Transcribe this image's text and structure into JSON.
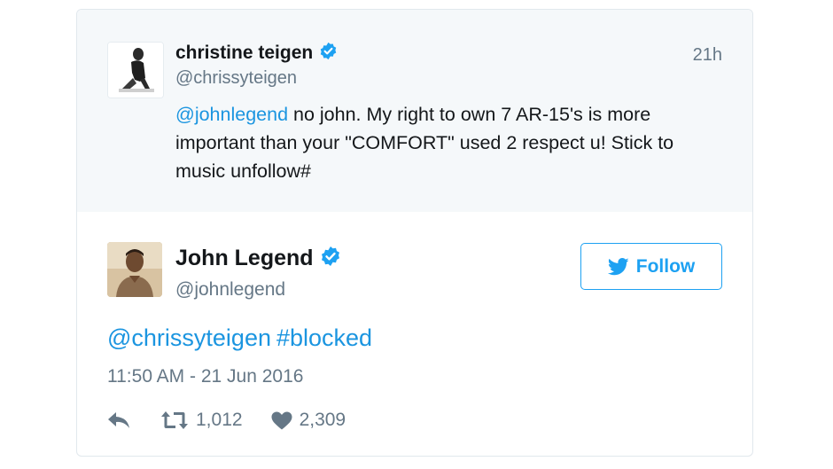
{
  "quoted_tweet": {
    "name": "christine teigen",
    "handle": "@chrissyteigen",
    "time": "21h",
    "mention": "@johnlegend",
    "text": " no john. My right to own 7 AR-15's is more important than your \"COMFORT\" used 2 respect u! Stick to music unfollow#"
  },
  "main_tweet": {
    "name": "John Legend",
    "handle": "@johnlegend",
    "follow_label": "Follow",
    "mention": "@chrissyteigen",
    "hashtag": "#blocked",
    "timestamp": "11:50 AM - 21 Jun 2016",
    "retweets": "1,012",
    "likes": "2,309"
  },
  "icons": {
    "verified": "verified-badge-icon",
    "reply": "reply-icon",
    "retweet": "retweet-icon",
    "like": "heart-icon",
    "follow": "twitter-bird-icon"
  },
  "colors": {
    "link": "#1b95e0",
    "accent": "#1da1f2",
    "muted": "#657786",
    "reply_bg": "#f5f8fa"
  }
}
